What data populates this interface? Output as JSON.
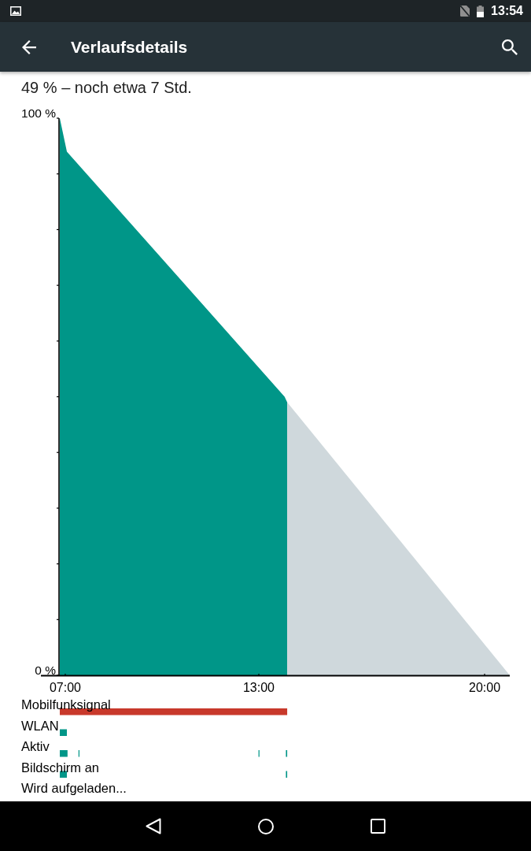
{
  "status_bar": {
    "time": "13:54"
  },
  "app_bar": {
    "title": "Verlaufsdetails"
  },
  "summary": "49 % – noch etwa 7 Std.",
  "chart": {
    "chart_data": {
      "type": "area",
      "x": [
        6.83,
        7.05,
        13.8,
        13.88,
        20.78
      ],
      "series": [
        {
          "color": "#009688",
          "values": [
            100,
            94,
            50,
            49,
            null
          ]
        },
        {
          "color": "#cfd8dc",
          "values": [
            null,
            null,
            null,
            49,
            0
          ]
        }
      ],
      "xlim": [
        6.83,
        20.78
      ],
      "ylim": [
        0,
        100
      ],
      "xticks": [
        {
          "value": 7,
          "label": "07:00"
        },
        {
          "value": 13,
          "label": "13:00"
        },
        {
          "value": 20,
          "label": "20:00"
        }
      ],
      "yticks": [
        {
          "value": 100,
          "label": "100 %"
        },
        {
          "value": 0,
          "label": "0 %"
        }
      ]
    }
  },
  "activity_lanes": [
    {
      "label": "Mobilfunksignal",
      "color": "#c8392b"
    },
    {
      "label": "WLAN",
      "color": "#009688"
    },
    {
      "label": "Aktiv",
      "color": "#009688"
    },
    {
      "label": "Bildschirm an",
      "color": "#009688"
    },
    {
      "label": "Wird aufgeladen..."
    }
  ]
}
